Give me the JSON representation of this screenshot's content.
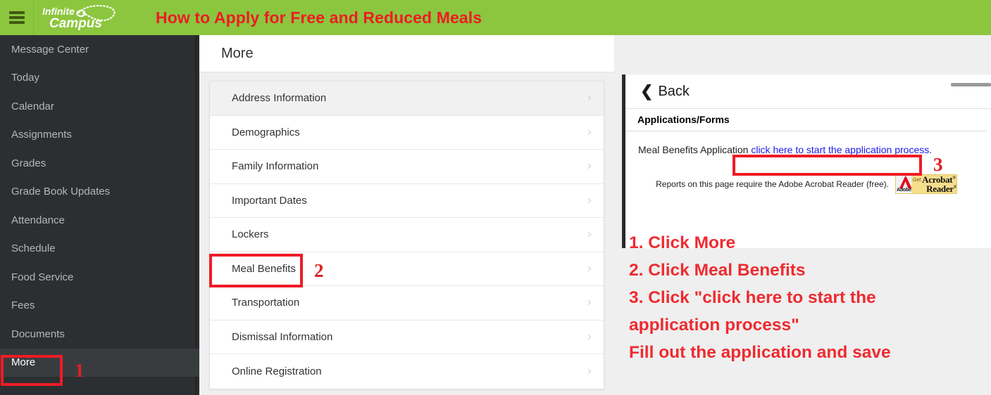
{
  "header": {
    "menu_icon": "hamburger-icon",
    "logo_line1": "Infinite",
    "logo_line2": "Campus",
    "banner_title": "How to Apply for Free and Reduced Meals",
    "green": "#8CC63E",
    "red": "#ED1C24"
  },
  "sidebar": {
    "items": [
      {
        "label": "Message Center",
        "active": false
      },
      {
        "label": "Today",
        "active": false
      },
      {
        "label": "Calendar",
        "active": false
      },
      {
        "label": "Assignments",
        "active": false
      },
      {
        "label": "Grades",
        "active": false
      },
      {
        "label": "Grade Book Updates",
        "active": false
      },
      {
        "label": "Attendance",
        "active": false
      },
      {
        "label": "Schedule",
        "active": false
      },
      {
        "label": "Food Service",
        "active": false
      },
      {
        "label": "Fees",
        "active": false
      },
      {
        "label": "Documents",
        "active": false
      },
      {
        "label": "More",
        "active": true
      }
    ]
  },
  "more_panel": {
    "title": "More",
    "items": [
      {
        "label": "Address Information",
        "hover": true
      },
      {
        "label": "Demographics",
        "hover": false
      },
      {
        "label": "Family Information",
        "hover": false
      },
      {
        "label": "Important Dates",
        "hover": false
      },
      {
        "label": "Lockers",
        "hover": false
      },
      {
        "label": "Meal Benefits",
        "hover": false
      },
      {
        "label": "Transportation",
        "hover": false
      },
      {
        "label": "Dismissal Information",
        "hover": false
      },
      {
        "label": "Online Registration",
        "hover": false
      }
    ],
    "chevron": "chevron-right-icon"
  },
  "detail_panel": {
    "back_label": "Back",
    "back_icon": "chevron-left-icon",
    "section_title": "Applications/Forms",
    "row_label": "Meal Benefits Application",
    "row_link": "click here to start the application process.",
    "footer_note": "Reports on this page require the Adobe Acrobat Reader (free).",
    "acrobat_badge": {
      "brand": "Adobe",
      "get": "Get",
      "word1": "Acrobat",
      "word2": "Reader"
    }
  },
  "annotations": {
    "step1": "1",
    "step2": "2",
    "step3": "3",
    "instructions": [
      "1. Click More",
      "2. Click Meal Benefits",
      "3. Click \"click here to start the",
      "application process\"",
      "Fill out the application and save"
    ]
  }
}
